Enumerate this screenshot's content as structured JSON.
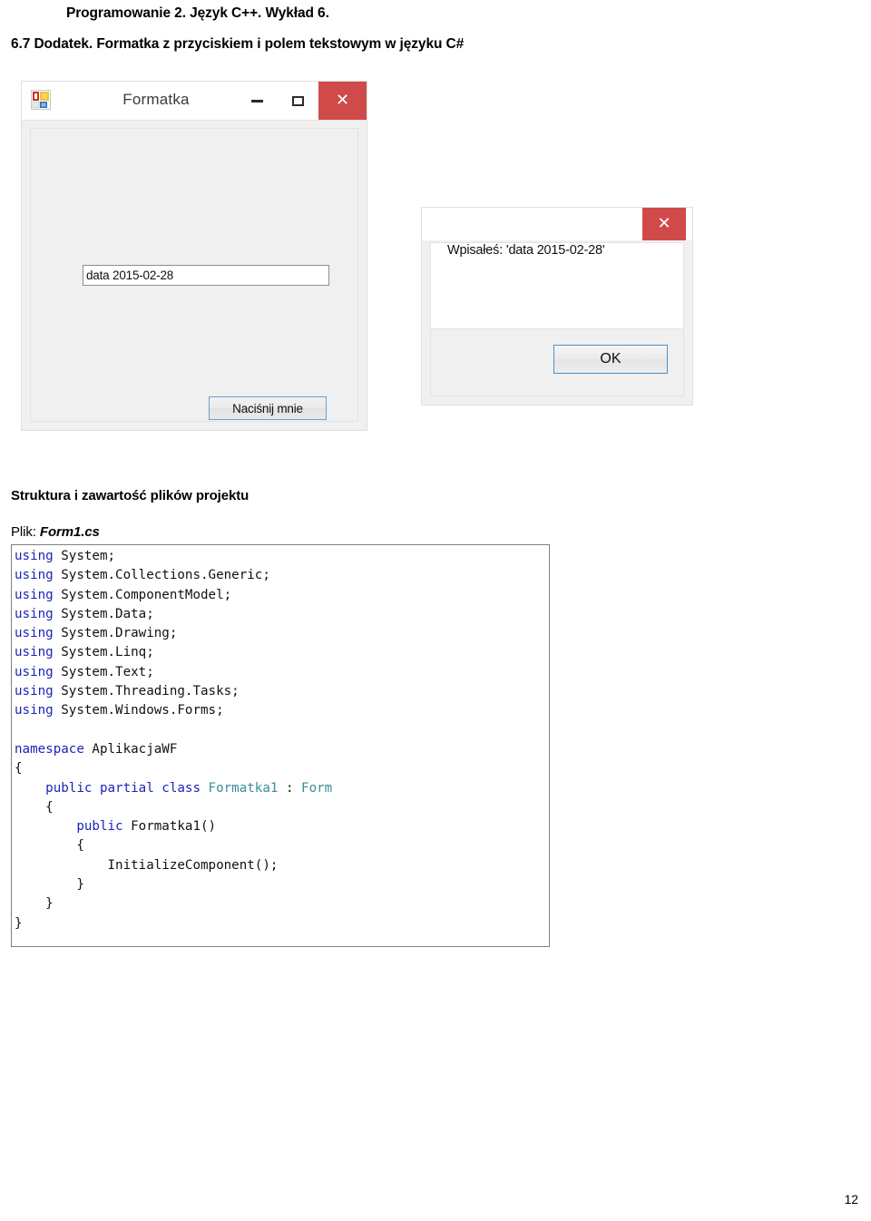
{
  "document": {
    "title": "Programowanie 2. Język C++. Wykład 6.",
    "subtitle": "6.7 Dodatek. Formatka z przyciskiem i polem tekstowym w języku C#",
    "section_heading": "Struktura i zawartość plików projektu",
    "file_label": "Plik: ",
    "file_name": "Form1.cs",
    "page_number": "12"
  },
  "winform": {
    "title": "Formatka",
    "icon": "visual-studio-blocks-icon",
    "titlebar_buttons": {
      "minimize": "−",
      "maximize": "▢",
      "close": "✕"
    },
    "textbox_value": "data 2015-02-28",
    "button_label": "Naciśnij mnie"
  },
  "messagebox": {
    "close_glyph": "✕",
    "message": "Wpisałeś: 'data 2015-02-28'",
    "ok_label": "OK"
  },
  "colors": {
    "close_button_red": "#d04a4a",
    "form_background": "#f0f0f0",
    "button_border_blue": "#4d90cd",
    "code_keyword_blue": "#1b24b8",
    "code_type_teal": "#3a8c9b"
  },
  "code": {
    "language": "csharp",
    "lines": [
      {
        "segments": [
          {
            "t": "using ",
            "c": "kw"
          },
          {
            "t": "System;",
            "c": "pl"
          }
        ]
      },
      {
        "segments": [
          {
            "t": "using ",
            "c": "kw"
          },
          {
            "t": "System.Collections.Generic;",
            "c": "pl"
          }
        ]
      },
      {
        "segments": [
          {
            "t": "using ",
            "c": "kw"
          },
          {
            "t": "System.ComponentModel;",
            "c": "pl"
          }
        ]
      },
      {
        "segments": [
          {
            "t": "using ",
            "c": "kw"
          },
          {
            "t": "System.Data;",
            "c": "pl"
          }
        ]
      },
      {
        "segments": [
          {
            "t": "using ",
            "c": "kw"
          },
          {
            "t": "System.Drawing;",
            "c": "pl"
          }
        ]
      },
      {
        "segments": [
          {
            "t": "using ",
            "c": "kw"
          },
          {
            "t": "System.Linq;",
            "c": "pl"
          }
        ]
      },
      {
        "segments": [
          {
            "t": "using ",
            "c": "kw"
          },
          {
            "t": "System.Text;",
            "c": "pl"
          }
        ]
      },
      {
        "segments": [
          {
            "t": "using ",
            "c": "kw"
          },
          {
            "t": "System.Threading.Tasks;",
            "c": "pl"
          }
        ]
      },
      {
        "segments": [
          {
            "t": "using ",
            "c": "kw"
          },
          {
            "t": "System.Windows.Forms;",
            "c": "pl"
          }
        ]
      },
      {
        "segments": []
      },
      {
        "segments": [
          {
            "t": "namespace ",
            "c": "kw"
          },
          {
            "t": "AplikacjaWF",
            "c": "pl"
          }
        ]
      },
      {
        "segments": [
          {
            "t": "{",
            "c": "pl"
          }
        ]
      },
      {
        "segments": [
          {
            "t": "    ",
            "c": "pl"
          },
          {
            "t": "public partial class ",
            "c": "kw"
          },
          {
            "t": "Formatka1",
            "c": "typ"
          },
          {
            "t": " : ",
            "c": "pl"
          },
          {
            "t": "Form",
            "c": "typ"
          }
        ]
      },
      {
        "segments": [
          {
            "t": "    {",
            "c": "pl"
          }
        ]
      },
      {
        "segments": [
          {
            "t": "        ",
            "c": "pl"
          },
          {
            "t": "public ",
            "c": "kw"
          },
          {
            "t": "Formatka1()",
            "c": "pl"
          }
        ]
      },
      {
        "segments": [
          {
            "t": "        {",
            "c": "pl"
          }
        ]
      },
      {
        "segments": [
          {
            "t": "            InitializeComponent();",
            "c": "pl"
          }
        ]
      },
      {
        "segments": [
          {
            "t": "        }",
            "c": "pl"
          }
        ]
      },
      {
        "segments": [
          {
            "t": "    }",
            "c": "pl"
          }
        ]
      },
      {
        "segments": [
          {
            "t": "}",
            "c": "pl"
          }
        ]
      }
    ]
  }
}
